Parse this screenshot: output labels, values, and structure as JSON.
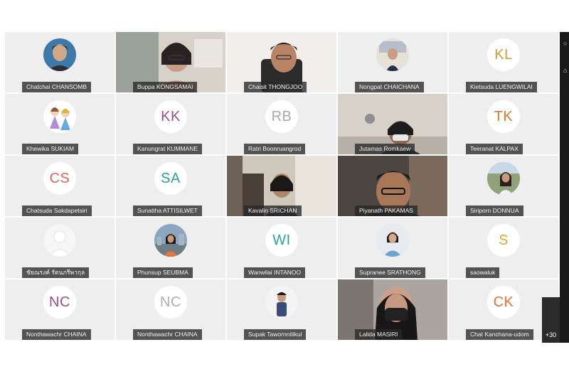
{
  "participants": [
    {
      "name": "Chatchai CHANSOMB",
      "type": "photo",
      "avatar": "man-portrait"
    },
    {
      "name": "Buppa KONGSAMAI",
      "type": "video",
      "scene": "woman-glasses-room"
    },
    {
      "name": "Chaisit THONGJOO",
      "type": "video",
      "scene": "man-office-chair"
    },
    {
      "name": "Nongpat CHAICHANA",
      "type": "photo",
      "avatar": "person-building"
    },
    {
      "name": "Kietsuda LUENGWILAI",
      "type": "initials",
      "initials": "KL",
      "color": "#d89a2c"
    },
    {
      "name": "Khewika SUKIAM",
      "type": "photo",
      "avatar": "cartoon-girls"
    },
    {
      "name": "Kanungrat KUMMANE",
      "type": "initials",
      "initials": "KK",
      "color": "#9b4f8f"
    },
    {
      "name": "Ratri Boonruangrod",
      "type": "initials",
      "initials": "RB",
      "color": "#a9a9a9"
    },
    {
      "name": "Jutamas Romkaew",
      "type": "video",
      "scene": "woman-mask-room"
    },
    {
      "name": "Teeranat KALPAX",
      "type": "initials",
      "initials": "TK",
      "color": "#e0772e"
    },
    {
      "name": "Chatsuda Sakdapetsiri",
      "type": "initials",
      "initials": "CS",
      "color": "#e0675c"
    },
    {
      "name": "Sunattha ATTISILWET",
      "type": "initials",
      "initials": "SA",
      "color": "#2aa39a"
    },
    {
      "name": "Kavalin SRICHAN",
      "type": "video",
      "scene": "woman-office-shelves"
    },
    {
      "name": "Piyanath PAKAMAS",
      "type": "video",
      "scene": "man-glasses-close"
    },
    {
      "name": "Siriporn DONNUA",
      "type": "photo",
      "avatar": "woman-outdoor"
    },
    {
      "name": "ชัยณรงค์ รัตนภรีพากุล",
      "type": "photo",
      "avatar": "default-silhouette"
    },
    {
      "name": "Phunsup SEUBMA",
      "type": "photo",
      "avatar": "woman-city"
    },
    {
      "name": "Wanwilai INTANOO",
      "type": "initials",
      "initials": "WI",
      "color": "#2aa39a"
    },
    {
      "name": "Supranee SRATHONG",
      "type": "photo",
      "avatar": "woman-blue-shirt"
    },
    {
      "name": "saowaluk",
      "type": "initials",
      "initials": "S",
      "color": "#e2a52c"
    },
    {
      "name": "Nonthawachr CHAINA",
      "type": "initials",
      "initials": "NC",
      "color": "#9b4f8f"
    },
    {
      "name": "Nonthawachr CHAINA",
      "type": "initials",
      "initials": "NC",
      "color": "#b0b0b0"
    },
    {
      "name": "Supak Tawornnitikul",
      "type": "photo",
      "avatar": "man-standing"
    },
    {
      "name": "Lalida MASIRI",
      "type": "video",
      "scene": "woman-mask-close"
    },
    {
      "name": "Chat Kanchana-udom",
      "type": "initials",
      "initials": "CK",
      "color": "#e0772e"
    }
  ],
  "more_count": "+30"
}
